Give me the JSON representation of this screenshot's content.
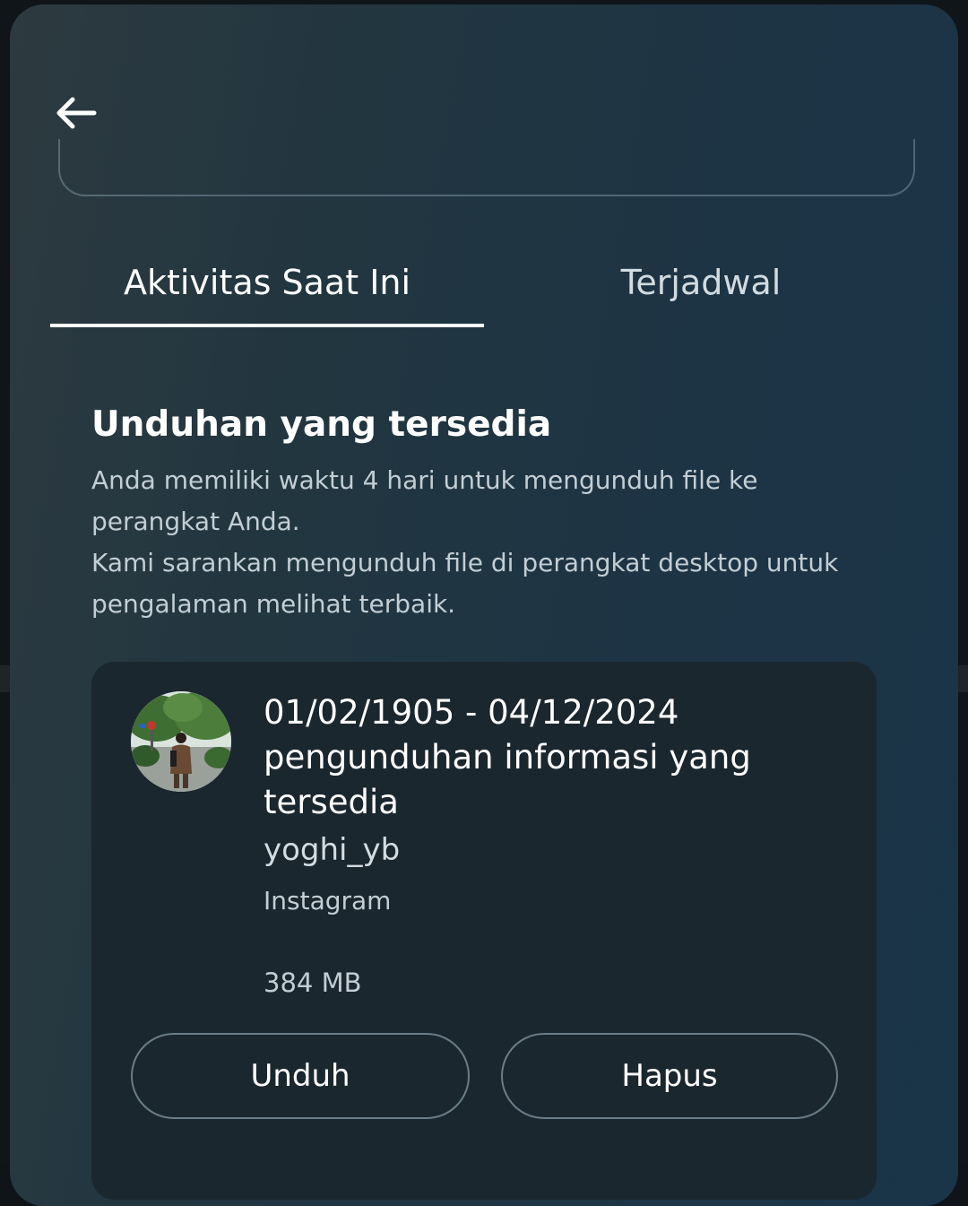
{
  "header": {
    "back_icon": "arrow-left-icon"
  },
  "tabs": [
    {
      "label": "Aktivitas Saat Ini",
      "active": true
    },
    {
      "label": "Terjadwal",
      "active": false
    }
  ],
  "section": {
    "title": "Unduhan yang tersedia",
    "description_lines": [
      "Anda memiliki waktu 4 hari untuk mengunduh file ke perangkat Anda.",
      "Kami sarankan mengunduh file di perangkat desktop untuk pengalaman melihat terbaik."
    ]
  },
  "download_card": {
    "title_lines": [
      "01/02/1905 - 04/12/2024",
      "pengunduhan informasi yang",
      "tersedia"
    ],
    "username": "yoghi_yb",
    "platform": "Instagram",
    "size": "384 MB",
    "download_label": "Unduh",
    "delete_label": "Hapus"
  },
  "colors": {
    "sheet_bg": "#223640",
    "card_bg": "#1b272f",
    "text_primary": "#ffffff",
    "text_secondary": "#c3ced4",
    "button_border": "#6a7d88"
  }
}
